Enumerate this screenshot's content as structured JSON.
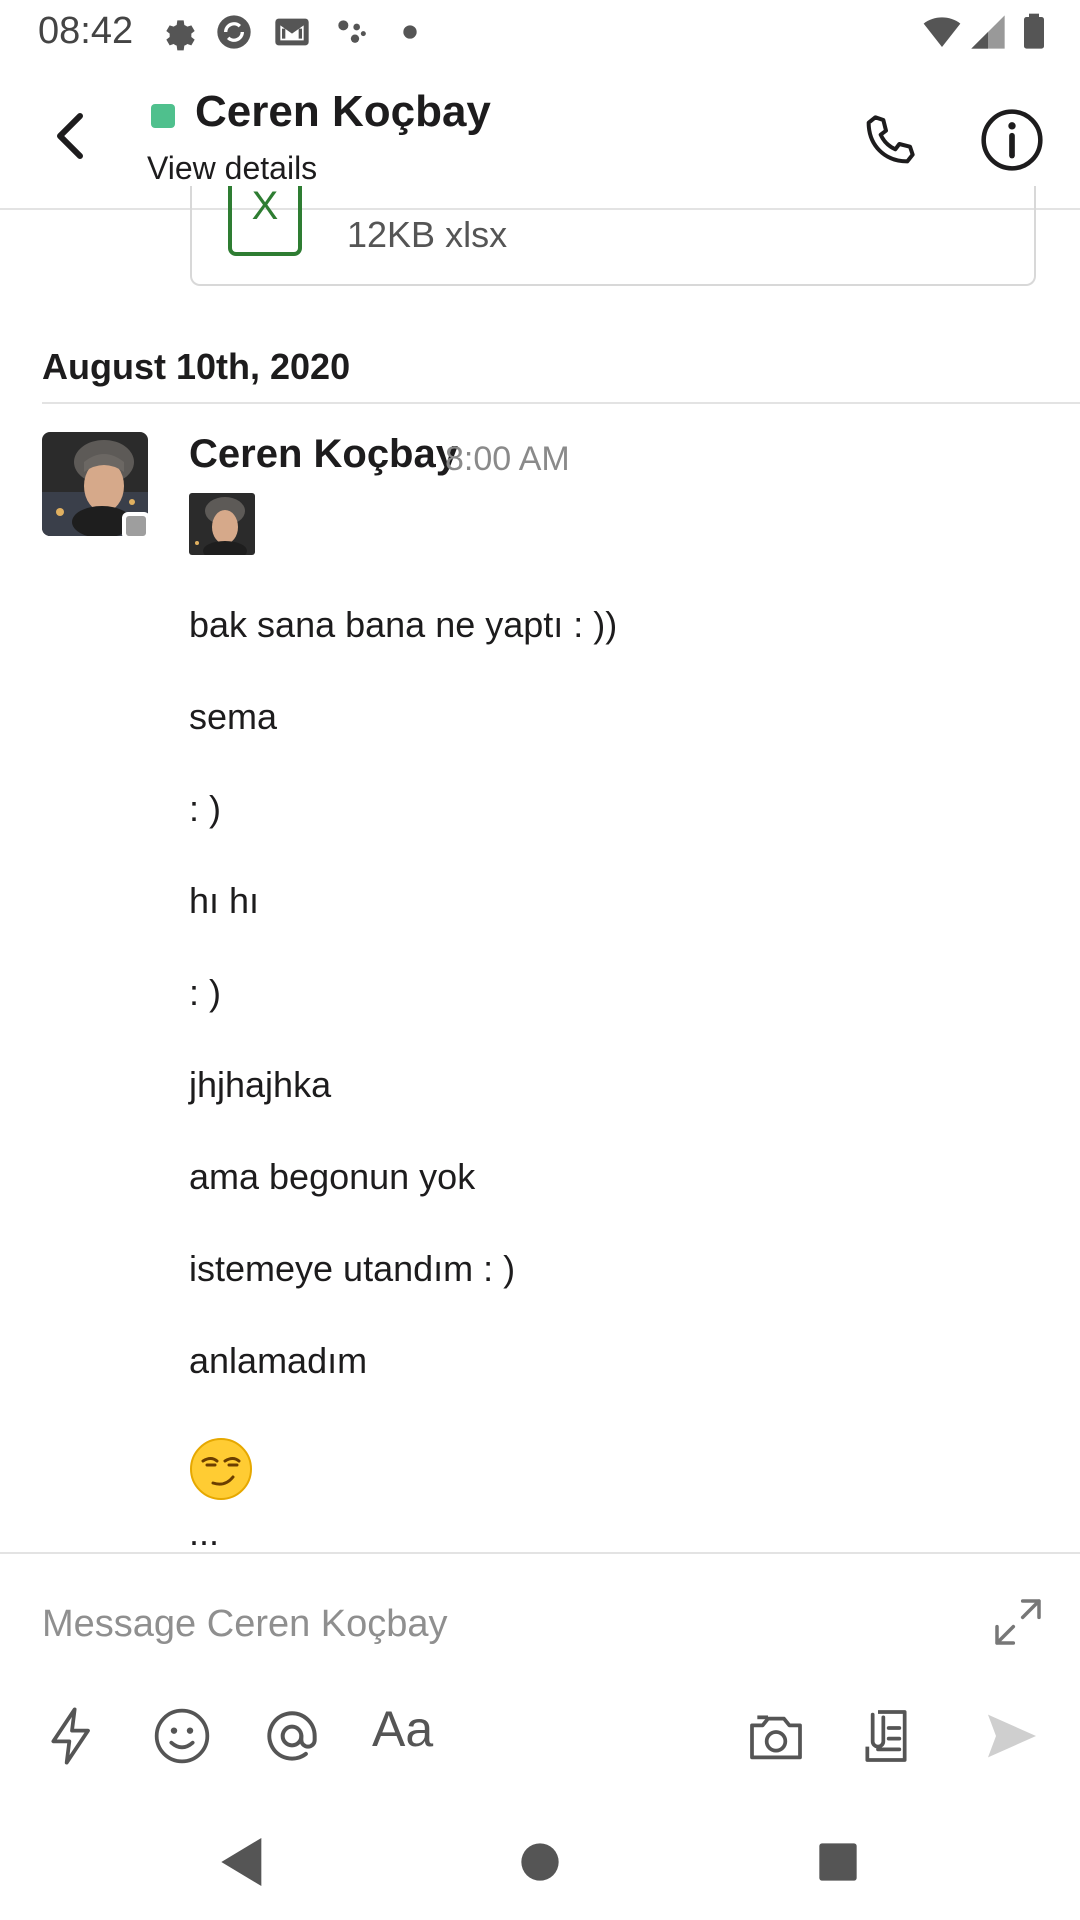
{
  "status_bar": {
    "time": "08:42",
    "icons": [
      "settings-icon",
      "sync-icon",
      "gmail-icon",
      "assistant-icon",
      "dot-icon",
      "wifi-icon",
      "signal-icon",
      "battery-icon"
    ]
  },
  "header": {
    "title": "Ceren Koçbay",
    "subtitle": "View details",
    "presence_color": "#4fc08d",
    "icons": [
      "back-icon",
      "phone-icon",
      "info-icon"
    ]
  },
  "file_attachment": {
    "icon_letter": "X",
    "meta": "12KB xlsx",
    "icon_color": "#2e7d32"
  },
  "date_divider": "August 10th, 2020",
  "message": {
    "author": "Ceren Koçbay",
    "time": "8:00 AM",
    "lines": [
      "bak sana bana ne yaptı : ))",
      "sema",
      ": )",
      "hı hı",
      ": )",
      "jhjhajhka",
      "ama begonun yok",
      "istemeye utandım : )",
      "anlamadım"
    ],
    "emoji": "smirking-face"
  },
  "composer": {
    "placeholder": "Message Ceren Koçbay",
    "aa_label": "Aa",
    "tools": [
      "shortcuts-icon",
      "emoji-icon",
      "mention-icon",
      "format-icon",
      "camera-icon",
      "attach-icon",
      "send-icon"
    ]
  },
  "nav": [
    "nav-back-icon",
    "nav-home-icon",
    "nav-recents-icon"
  ]
}
